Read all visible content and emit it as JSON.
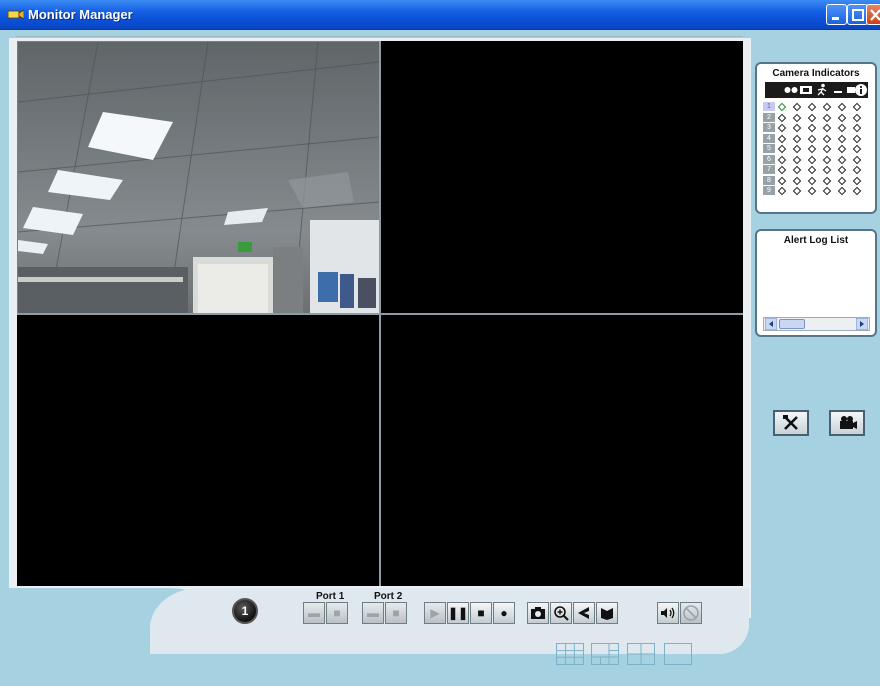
{
  "window": {
    "title": "Monitor Manager",
    "controls": [
      "minimize",
      "maximize",
      "close"
    ]
  },
  "camera_indicators": {
    "title": "Camera Indicators",
    "rows": [
      "1",
      "2",
      "3",
      "4",
      "5",
      "6",
      "7",
      "8",
      "9"
    ],
    "active_row": "1",
    "column_icons": [
      "glasses-icon",
      "camera-icon",
      "motion-icon",
      "dash-icon",
      "monitor-icon",
      "info-icon"
    ]
  },
  "alert_log": {
    "title": "Alert Log List"
  },
  "control_bar": {
    "channel_number": "1",
    "port1_label": "Port 1",
    "port2_label": "Port 2"
  },
  "colors": {
    "titlebar": "#0b50d6",
    "background": "#a6d1e1",
    "active_border": "#2fb52f"
  }
}
